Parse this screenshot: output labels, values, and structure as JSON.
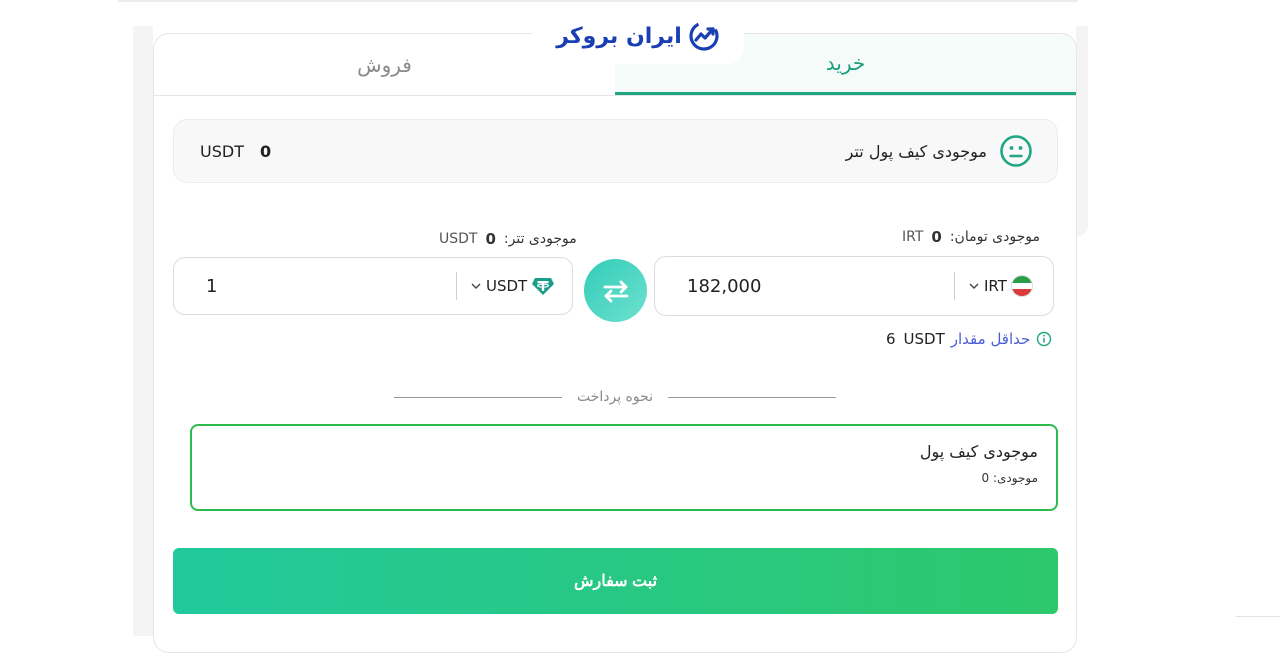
{
  "logo": {
    "text": "ایران بروکر"
  },
  "tabs": {
    "sell": "فروش",
    "buy": "خرید"
  },
  "wallet": {
    "label": "موجودی کیف پول تتر",
    "amount": "0",
    "currency": "USDT"
  },
  "toman_balance": {
    "label": "موجودی تومان:",
    "amount": "0",
    "currency": "IRT"
  },
  "tether_balance": {
    "label": "موجودی تتر:",
    "amount": "0",
    "currency": "USDT"
  },
  "irt_field": {
    "value": "182,000",
    "currency": "IRT"
  },
  "usdt_field": {
    "value": "1",
    "currency": "USDT"
  },
  "min_amount": {
    "label": "حداقل مقدار",
    "currency": "USDT",
    "amount": "6"
  },
  "payment": {
    "divider_text": "نحوه پرداخت",
    "method_title": "موجودی کیف پول",
    "method_balance": "موجودی: 0"
  },
  "submit": {
    "label": "ثبت سفارش"
  },
  "colors": {
    "accent": "#1fa784",
    "brand": "#1a3fb3",
    "success_border": "#2dbb4b",
    "link": "#4a5fd6"
  }
}
